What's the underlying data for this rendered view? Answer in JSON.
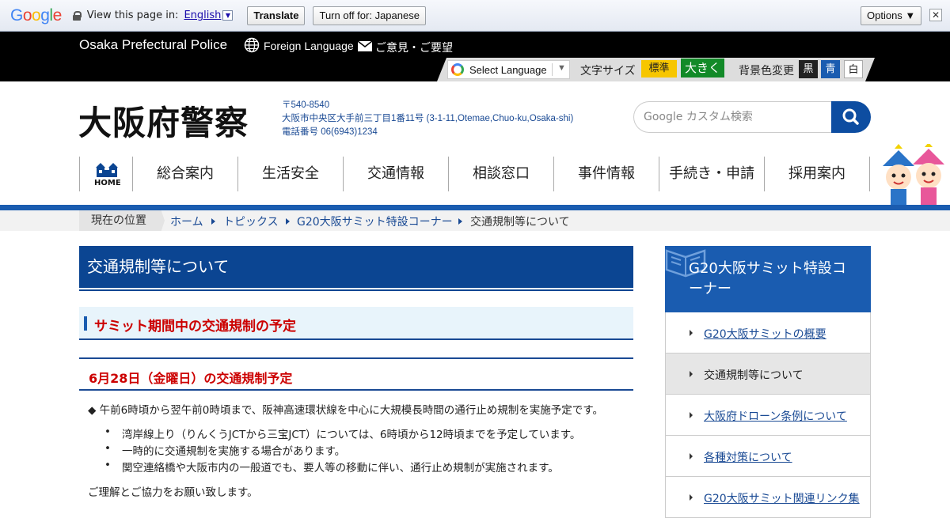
{
  "translate_bar": {
    "logo": "Google",
    "view_label": "View this page in:",
    "language": "English",
    "dropdown_glyph": "▼",
    "translate_button": "Translate",
    "turn_off_button": "Turn off for: Japanese",
    "options_button": "Options ▼",
    "close_glyph": "✕"
  },
  "header": {
    "site_name": "Osaka Prefectural Police",
    "foreign_language": "Foreign Language",
    "opinion": "ご意見・ご要望",
    "select_language": "Select Language",
    "select_arrow": "▼",
    "font_size_label": "文字サイズ",
    "font_standard": "標準",
    "font_large": "大きく",
    "bg_color_label": "背景色変更",
    "bg_black": "黒",
    "bg_blue": "青",
    "bg_white": "白"
  },
  "logo": {
    "title": "大阪府警察",
    "postal": "〒540-8540",
    "address": "大阪市中央区大手前三丁目1番11号 (3-1-11,Otemae,Chuo-ku,Osaka-shi)",
    "phone": "電話番号 06(6943)1234"
  },
  "search": {
    "placeholder": "Google カスタム検索"
  },
  "nav": {
    "home": "HOME",
    "items": [
      "総合案内",
      "生活安全",
      "交通情報",
      "相談窓口",
      "事件情報",
      "手続き・申請",
      "採用案内"
    ]
  },
  "breadcrumb": {
    "here": "現在の位置",
    "links": [
      "ホーム",
      "トピックス",
      "G20大阪サミット特設コーナー"
    ],
    "current": "交通規制等について"
  },
  "main": {
    "page_title": "交通規制等について",
    "heading2": "サミット期間中の交通規制の予定",
    "heading3": "6月28日（金曜日）の交通規制予定",
    "lead": "◆ 午前6時頃から翌午前0時頃まで、阪神高速環状線を中心に大規模長時間の通行止め規制を実施予定です。",
    "bullets": [
      "湾岸線上り（りんくうJCTから三宝JCT）については、6時頃から12時頃までを予定しています。",
      "一時的に交通規制を実施する場合があります。",
      "関空連絡橋や大阪市内の一般道でも、要人等の移動に伴い、通行止め規制が実施されます。"
    ],
    "thanks": "ご理解とご協力をお願い致します。"
  },
  "sidebar": {
    "title": "G20大阪サミット特設コーナー",
    "items": [
      {
        "label": "G20大阪サミットの概要"
      },
      {
        "label": "交通規制等について"
      },
      {
        "label": "大阪府ドローン条例について"
      },
      {
        "label": "各種対策について"
      },
      {
        "label": "G20大阪サミット関連リンク集"
      }
    ]
  },
  "colors": {
    "primary_blue": "#0b4592",
    "accent_blue": "#1a5cb0",
    "heading_red": "#cc0000",
    "font_std_yellow": "#f7c600",
    "font_large_green": "#128a28"
  }
}
